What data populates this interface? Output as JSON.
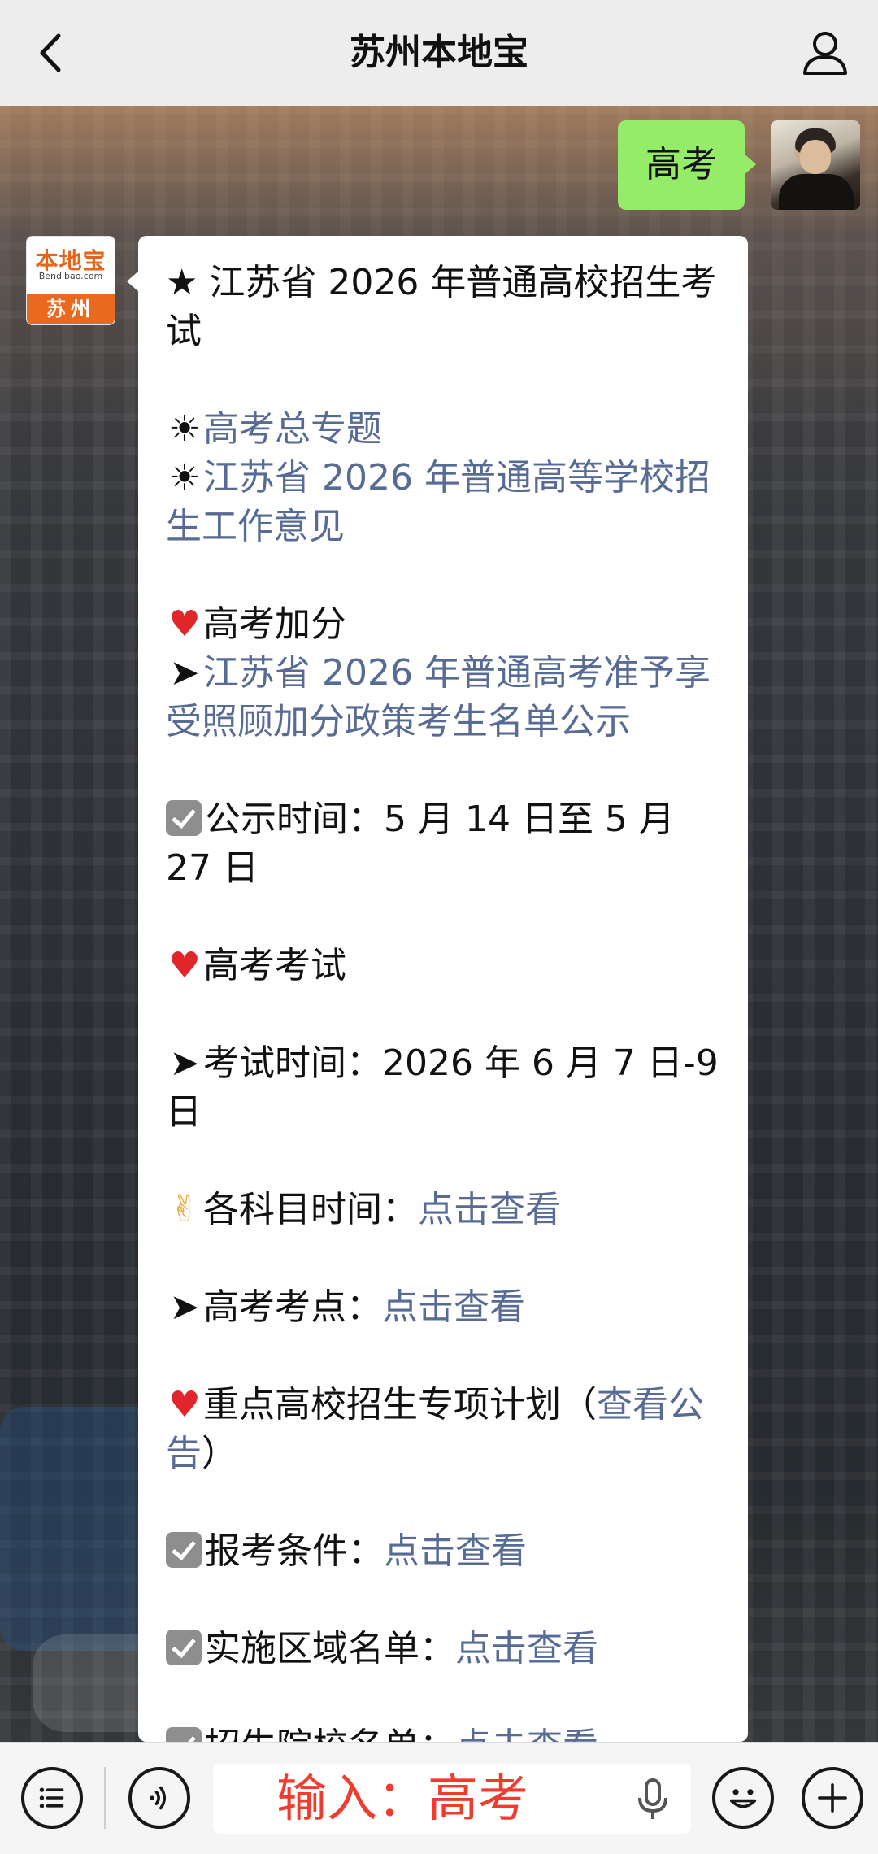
{
  "header": {
    "title": "苏州本地宝",
    "back_icon": "chevron-left-icon",
    "profile_icon": "user-icon"
  },
  "user_message": {
    "text": "高考"
  },
  "bot": {
    "avatar_logo": "本地宝",
    "avatar_sub": "Bendibao.com",
    "avatar_city": "苏州"
  },
  "message": {
    "headline": "★ 江苏省 2026 年普通高校招生考试",
    "topic_link": "高考总专题",
    "opinion_link": "江苏省 2026 年普通高等学校招生工作意见",
    "bonus_heading": "高考加分",
    "bonus_link": "江苏省 2026 年普通高考准予享受照顾加分政策考生名单公示",
    "announce_time": "公示时间：5 月 14 日至 5 月 27 日",
    "exam_heading": "高考考试",
    "exam_time": "考试时间：2026 年 6 月 7 日-9 日",
    "subjects_label": "各科目时间：",
    "subjects_link": "点击查看",
    "sites_label": "高考考点：",
    "sites_link": "点击查看",
    "plan_label": "重点高校招生专项计划（",
    "plan_link": "查看公告",
    "plan_close": "）",
    "conditions_label": "报考条件：",
    "conditions_link": "点击查看",
    "area_label": "实施区域名单：",
    "area_link": "点击查看",
    "schools_label": "招生院校名单：",
    "schools_link": "点击查看"
  },
  "input": {
    "text": "输入：高考"
  },
  "colors": {
    "link": "#576b95",
    "user_bubble": "#95ec69",
    "input_text": "#f03c2e",
    "brand": "#e9691e"
  }
}
